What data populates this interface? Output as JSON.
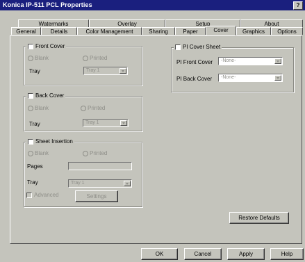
{
  "window": {
    "title": "Konica IP-511 PCL Properties",
    "help_label": "?"
  },
  "tabs_row1": [
    {
      "label": "Watermarks"
    },
    {
      "label": "Overlay"
    },
    {
      "label": "Setup"
    },
    {
      "label": "About"
    }
  ],
  "tabs_row2": [
    {
      "label": "General"
    },
    {
      "label": "Details"
    },
    {
      "label": "Color Management"
    },
    {
      "label": "Sharing"
    },
    {
      "label": "Paper"
    },
    {
      "label": "Cover",
      "active": true
    },
    {
      "label": "Graphics"
    },
    {
      "label": "Options"
    }
  ],
  "front_cover": {
    "label": "Front Cover",
    "checked": false,
    "blank_label": "Blank",
    "printed_label": "Printed",
    "tray_label": "Tray",
    "tray_value": "Tray 1"
  },
  "back_cover": {
    "label": "Back Cover",
    "checked": false,
    "blank_label": "Blank",
    "printed_label": "Printed",
    "tray_label": "Tray",
    "tray_value": "Tray 1"
  },
  "sheet_insertion": {
    "label": "Sheet Insertion",
    "checked": false,
    "blank_label": "Blank",
    "printed_label": "Printed",
    "pages_label": "Pages",
    "pages_value": "",
    "tray_label": "Tray",
    "tray_value": "Tray 1",
    "advanced_label": "Advanced",
    "settings_label": "Settings"
  },
  "pi_cover_sheet": {
    "label": "PI Cover Sheet",
    "checked": false,
    "front_label": "PI Front Cover",
    "front_value": "-None-",
    "back_label": "PI Back Cover",
    "back_value": "-None-"
  },
  "restore_defaults_label": "Restore Defaults",
  "buttons": {
    "ok": "OK",
    "cancel": "Cancel",
    "apply": "Apply",
    "help": "Help"
  }
}
